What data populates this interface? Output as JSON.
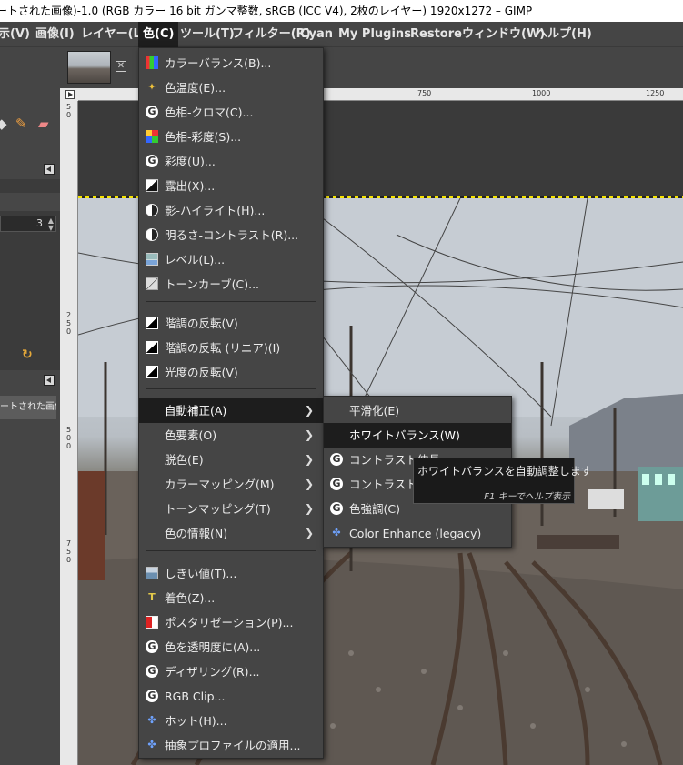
{
  "window": {
    "title": "ートされた画像)-1.0 (RGB カラー 16 bit ガンマ整数, sRGB (ICC V4), 2枚のレイヤー) 1920x1272 – GIMP"
  },
  "menubar": [
    {
      "label": "示(V)"
    },
    {
      "label": "画像(I)"
    },
    {
      "label": "レイヤー(L)"
    },
    {
      "label": "色(C)"
    },
    {
      "label": "ツール(T)"
    },
    {
      "label": "フィルター(R)"
    },
    {
      "label": "Cyan"
    },
    {
      "label": "My Plugins"
    },
    {
      "label": "Restore"
    },
    {
      "label": "ウィンドウ(W)"
    },
    {
      "label": "ヘルプ(H)"
    }
  ],
  "left_dock": {
    "spin_value": "3",
    "image_tab_label": "ートされた画像)-"
  },
  "rulers": {
    "h_ticks": [
      "750",
      "1000",
      "1250"
    ],
    "v_marks": [
      [
        "5",
        "0"
      ],
      [
        "2",
        "5",
        "0"
      ],
      [
        "5",
        "0",
        "0"
      ],
      [
        "7",
        "5",
        "0"
      ]
    ]
  },
  "colors_menu": {
    "items": [
      {
        "label": "カラーバランス(B)...",
        "icon": "color-balance-icon"
      },
      {
        "label": "色温度(E)...",
        "icon": "color-temperature-icon"
      },
      {
        "label": "色相-クロマ(C)...",
        "icon": "gegl-icon"
      },
      {
        "label": "色相-彩度(S)...",
        "icon": "hue-saturation-icon"
      },
      {
        "label": "彩度(U)...",
        "icon": "gegl-icon"
      },
      {
        "label": "露出(X)...",
        "icon": "exposure-icon"
      },
      {
        "label": "影-ハイライト(H)...",
        "icon": "shadows-highlights-icon"
      },
      {
        "label": "明るさ-コントラスト(R)...",
        "icon": "brightness-contrast-icon"
      },
      {
        "label": "レベル(L)...",
        "icon": "levels-icon"
      },
      {
        "label": "トーンカーブ(C)...",
        "icon": "curves-icon"
      },
      {
        "label": "階調の反転(V)",
        "icon": "invert-icon"
      },
      {
        "label": "階調の反転 (リニア)(I)",
        "icon": "invert-icon"
      },
      {
        "label": "光度の反転(V)",
        "icon": "invert-icon"
      },
      {
        "label": "自動補正(A)",
        "submenu": true
      },
      {
        "label": "色要素(O)",
        "submenu": true
      },
      {
        "label": "脱色(E)",
        "submenu": true
      },
      {
        "label": "カラーマッピング(M)",
        "submenu": true
      },
      {
        "label": "トーンマッピング(T)",
        "submenu": true
      },
      {
        "label": "色の情報(N)",
        "submenu": true
      },
      {
        "label": "しきい値(T)...",
        "icon": "threshold-icon"
      },
      {
        "label": "着色(Z)...",
        "icon": "colorize-icon"
      },
      {
        "label": "ポスタリゼーション(P)...",
        "icon": "posterize-icon"
      },
      {
        "label": "色を透明度に(A)...",
        "icon": "gegl-icon"
      },
      {
        "label": "ディザリング(R)...",
        "icon": "gegl-icon"
      },
      {
        "label": "RGB Clip...",
        "icon": "gegl-icon"
      },
      {
        "label": "ホット(H)...",
        "icon": "plugin-icon"
      },
      {
        "label": "抽象プロファイルの適用...",
        "icon": "plugin-icon"
      }
    ]
  },
  "auto_submenu": {
    "items": [
      {
        "label": "平滑化(E)"
      },
      {
        "label": "ホワイトバランス(W)"
      },
      {
        "label": "コントラスト伸長",
        "icon": "gegl-icon"
      },
      {
        "label": "コントラスト H",
        "icon": "gegl-icon"
      },
      {
        "label": "色強調(C)",
        "icon": "gegl-icon"
      },
      {
        "label": "Color Enhance (legacy)",
        "icon": "plugin-icon"
      }
    ]
  },
  "tooltip": {
    "text": "ホワイトバランスを自動調整します",
    "help": "F1 キーでヘルプ表示"
  },
  "theme": {
    "menu_bg": "#454545",
    "highlight": "#1d1d1d",
    "selection_marching_ants": "#f5e300"
  }
}
